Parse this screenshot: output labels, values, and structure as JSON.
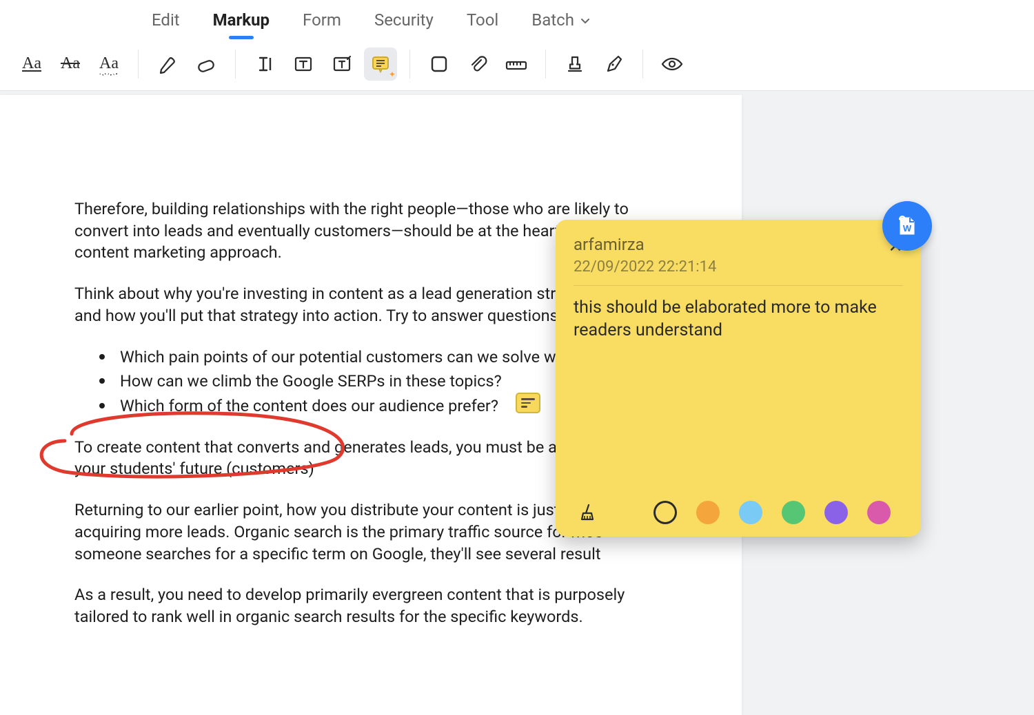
{
  "tabs": {
    "edit": "Edit",
    "markup": "Markup",
    "form": "Form",
    "security": "Security",
    "tool": "Tool",
    "batch": "Batch"
  },
  "active_tab": "markup",
  "toolbar": {
    "active_tool": "sticky-note"
  },
  "document": {
    "p1": "Therefore, building relationships with the right people—those who are likely to convert into leads and eventually customers—should be at the heart of your content marketing approach.",
    "p2": "Think about why you're investing in content as a lead generation strategy place and how you'll put that strategy into action. Try to answer questions",
    "bullets": [
      "Which pain points of our potential customers can we solve with fre",
      "How can we climb the Google SERPs in these topics?",
      "Which form of the content does our audience prefer?"
    ],
    "p3": "To create content that converts and generates leads, you must be a teach about your students' future (customers)",
    "p4": "Returning to our earlier point, how you distribute your content is just as cr acquiring more leads. Organic search is the primary traffic source for mos someone searches for a specific term on Google, they'll see several result",
    "p5": "As a result, you need to develop primarily evergreen content that is purposely tailored to rank well in organic search results for the specific keywords."
  },
  "note": {
    "author": "arfamirza",
    "timestamp": "22/09/2022 22:21:14",
    "text": "this should be elaborated more to make readers understand",
    "close": "✕",
    "colors": {
      "yellow": "#f9dc62",
      "orange": "#f4a53b",
      "blue": "#79caf5",
      "green": "#56c574",
      "purple": "#8a62e8",
      "pink": "#d95aab"
    }
  },
  "fab": {
    "label": "W"
  }
}
